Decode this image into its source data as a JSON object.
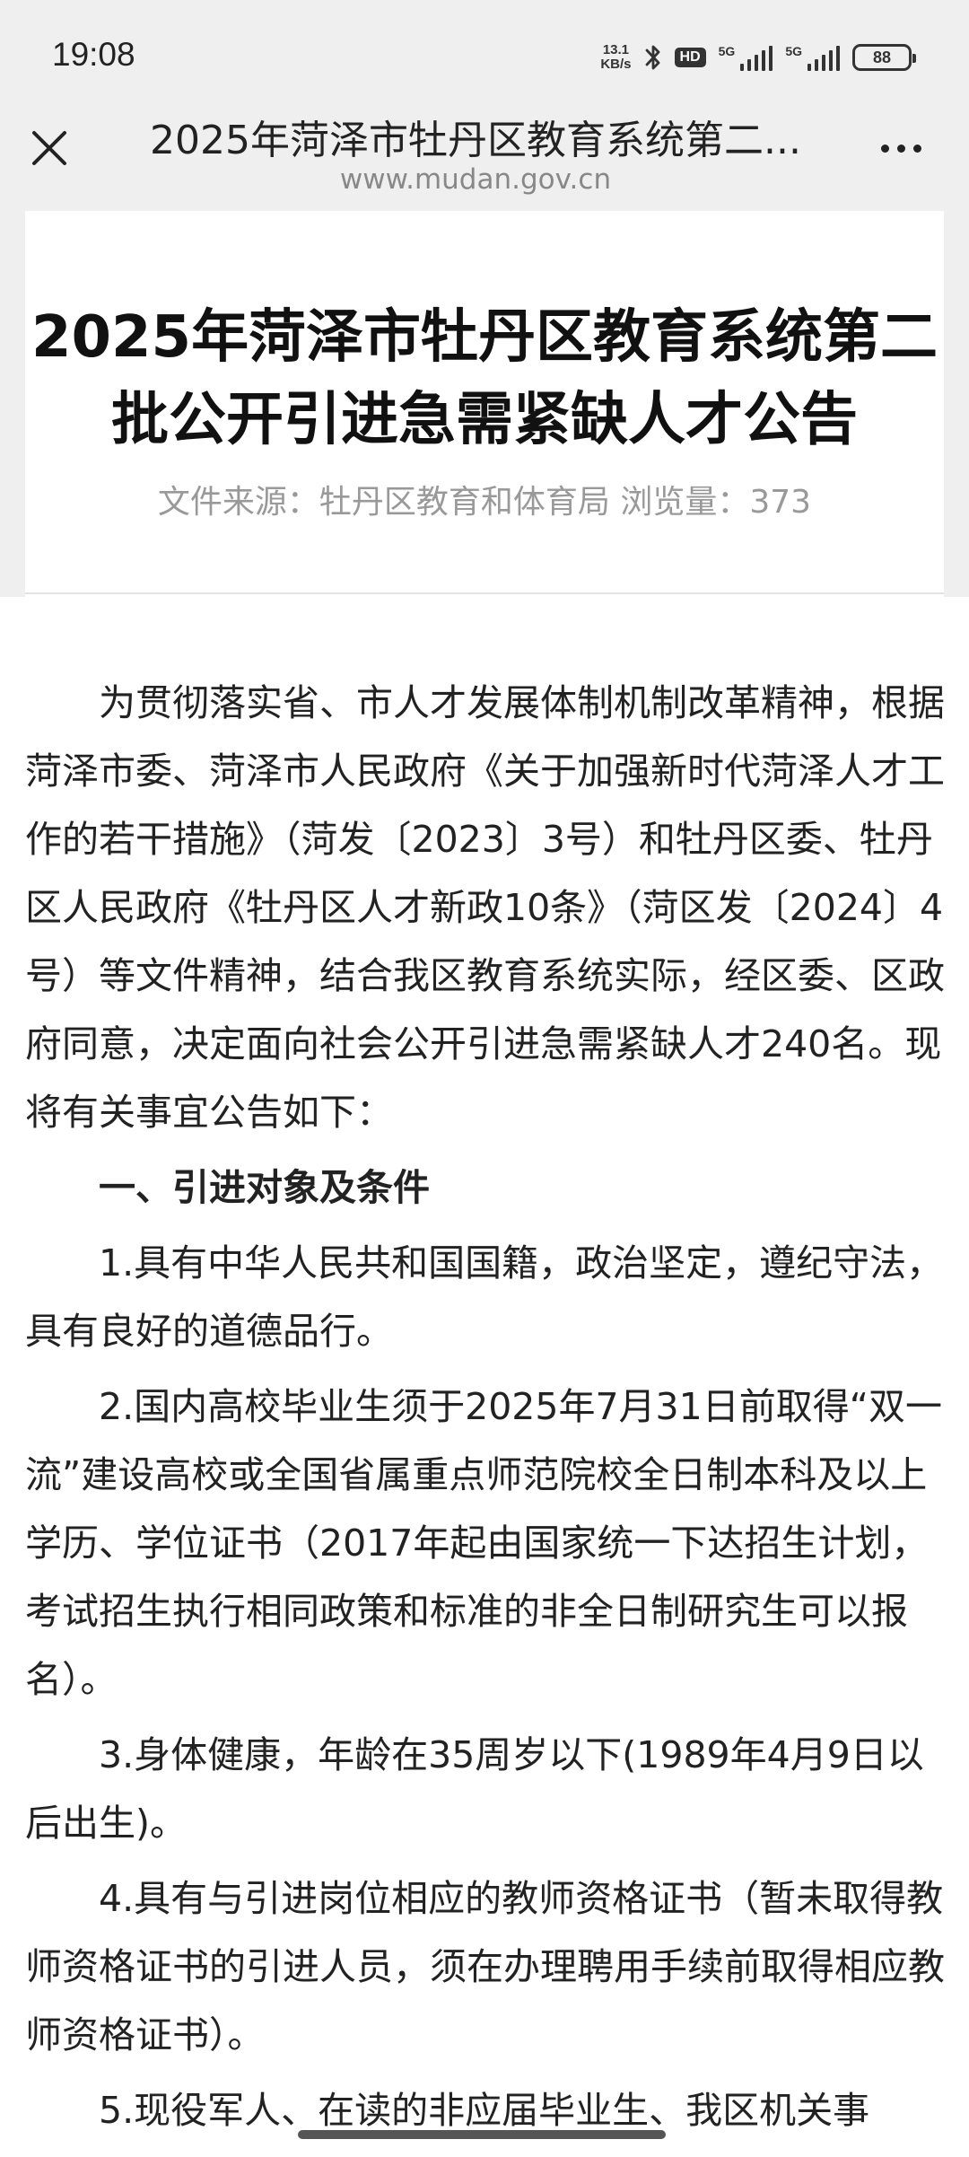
{
  "status_bar": {
    "time": "19:08",
    "net_speed_value": "13.1",
    "net_speed_unit": "KB/s",
    "hd_label": "HD",
    "sim1_label": "5G",
    "sim2_label": "5G",
    "battery": "88"
  },
  "nav": {
    "title": "2025年菏泽市牡丹区教育系统第二...",
    "url": "www.mudan.gov.cn"
  },
  "article": {
    "title": "2025年菏泽市牡丹区教育系统第二批公开引进急需紧缺人才公告",
    "meta": "文件来源：牡丹区教育和体育局 浏览量：373",
    "paragraphs": [
      "为贯彻落实省、市人才发展体制机制改革精神，根据菏泽市委、菏泽市人民政府《关于加强新时代菏泽人才工作的若干措施》（菏发〔2023〕3号）和牡丹区委、牡丹区人民政府《牡丹区人才新政10条》（菏区发〔2024〕4号）等文件精神，结合我区教育系统实际，经区委、区政府同意，决定面向社会公开引进急需紧缺人才240名。现将有关事宜公告如下：",
      "一、引进对象及条件",
      "1.具有中华人民共和国国籍，政治坚定，遵纪守法，具有良好的道德品行。",
      "2.国内高校毕业生须于2025年7月31日前取得“双一流”建设高校或全国省属重点师范院校全日制本科及以上学历、学位证书（2017年起由国家统一下达招生计划，考试招生执行相同政策和标准的非全日制研究生可以报名）。",
      "3.身体健康，年龄在35周岁以下(1989年4月9日以后出生)。",
      "4.具有与引进岗位相应的教师资格证书（暂未取得教师资格证书的引进人员，须在办理聘用手续前取得相应教师资格证书）。",
      "5.现役军人、在读的非应届毕业生、我区机关事"
    ]
  }
}
